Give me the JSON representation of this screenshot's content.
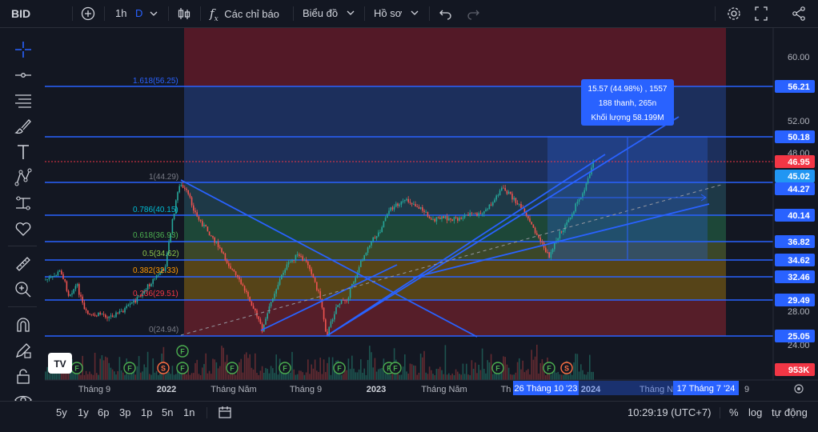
{
  "toolbar": {
    "symbol": "BID",
    "interval": "1h",
    "d_label": "D",
    "indicators_label": "Các chỉ báo",
    "chart_label": "Biểu đồ",
    "profile_label": "Hồ sơ"
  },
  "left_tools": [
    "crosshair-icon",
    "horizontal-line-icon",
    "fib-retracement-icon",
    "brush-icon",
    "text-icon",
    "pattern-icon",
    "measure-icon",
    "heart-icon",
    "ruler-icon",
    "zoom-in-icon",
    "magnet-icon",
    "lock-pencil-icon",
    "lock-icon",
    "eye-icon",
    "trash-icon"
  ],
  "price_axis": {
    "ticks": [
      "60.00",
      "52.00",
      "48.00",
      "28.00",
      "24.00"
    ],
    "levels": [
      {
        "label": "56.21",
        "color": "#2962ff"
      },
      {
        "label": "50.18",
        "color": "#2962ff"
      },
      {
        "label": "46.95",
        "color": "#f23645"
      },
      {
        "label": "45.02",
        "color": "#2196f3"
      },
      {
        "label": "44.27",
        "color": "#2962ff"
      },
      {
        "label": "40.14",
        "color": "#2962ff"
      },
      {
        "label": "36.82",
        "color": "#2962ff"
      },
      {
        "label": "34.62",
        "color": "#2962ff"
      },
      {
        "label": "32.46",
        "color": "#2962ff"
      },
      {
        "label": "29.49",
        "color": "#2962ff"
      },
      {
        "label": "25.05",
        "color": "#2962ff"
      },
      {
        "label": "953K",
        "color": "#f23645"
      }
    ]
  },
  "fib_labels": [
    {
      "text": "1.618(56.25)",
      "color": "#2962ff"
    },
    {
      "text": "1(44.29)",
      "color": "#787b86"
    },
    {
      "text": "0.786(40.15)",
      "color": "#00bcd4"
    },
    {
      "text": "0.618(36.93)",
      "color": "#4caf50"
    },
    {
      "text": "0.5(34.62)",
      "color": "#8bc34a"
    },
    {
      "text": "0.382(32.33)",
      "color": "#ff9800"
    },
    {
      "text": "0.236(29.51)",
      "color": "#f23645"
    },
    {
      "text": "0(24.94)",
      "color": "#787b86"
    }
  ],
  "measure_box": {
    "line1": "15.57 (44.98%) , 1557",
    "line2": "188 thanh, 265n",
    "line3": "Khối lượng 58.199M"
  },
  "time_axis": {
    "labels": [
      "Tháng 9",
      "2022",
      "Tháng Năm",
      "Tháng 9",
      "2023",
      "Tháng Năm",
      "Th",
      "2024",
      "Tháng N",
      "9"
    ],
    "highlight_start": "26 Tháng 10 '23",
    "highlight_end": "17 Tháng 7 '24"
  },
  "event_markers": [
    "F",
    "F",
    "S",
    "F",
    "F",
    "F",
    "F",
    "F",
    "F",
    "F",
    "F",
    "F",
    "S"
  ],
  "bottom": {
    "ranges": [
      "5y",
      "1y",
      "6p",
      "3p",
      "1p",
      "5n",
      "1n"
    ],
    "time": "10:29:19 (UTC+7)",
    "percent": "%",
    "log": "log",
    "auto": "tự động"
  }
}
